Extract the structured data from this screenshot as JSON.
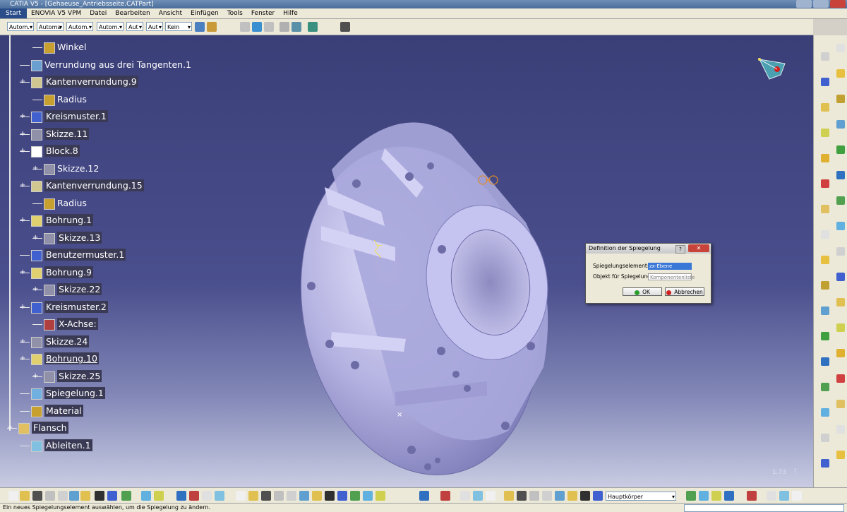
{
  "window": {
    "title": "CATIA V5 - [Gehaeuse_Antriebsseite.CATPart]"
  },
  "menu": {
    "start": "Start",
    "items": [
      "ENOVIA V5 VPM",
      "Datei",
      "Bearbeiten",
      "Ansicht",
      "Einfügen",
      "Tools",
      "Fenster",
      "Hilfe"
    ]
  },
  "toolbar": {
    "combos": [
      "Autom.",
      "Automa",
      "Autom.",
      "Autom.",
      "Aut",
      "Aut",
      "Kein"
    ]
  },
  "tree": {
    "items": [
      {
        "label": "Winkel",
        "icon": "parameter-icon"
      },
      {
        "label": "Verrundung aus drei Tangenten.1",
        "icon": "fillet-icon"
      },
      {
        "label": "Kantenverrundung.9",
        "icon": "edge-fillet-icon"
      },
      {
        "label": "Radius",
        "icon": "parameter-icon"
      },
      {
        "label": "Kreismuster.1",
        "icon": "circular-pattern-icon"
      },
      {
        "label": "Skizze.11",
        "icon": "sketch-icon"
      },
      {
        "label": "Block.8",
        "icon": "pad-icon"
      },
      {
        "label": "Skizze.12",
        "icon": "sketch-icon"
      },
      {
        "label": "Kantenverrundung.15",
        "icon": "edge-fillet-icon"
      },
      {
        "label": "Radius",
        "icon": "parameter-icon"
      },
      {
        "label": "Bohrung.1",
        "icon": "hole-icon"
      },
      {
        "label": "Skizze.13",
        "icon": "sketch-icon"
      },
      {
        "label": "Benutzermuster.1",
        "icon": "user-pattern-icon"
      },
      {
        "label": "Bohrung.9",
        "icon": "hole-icon"
      },
      {
        "label": "Skizze.22",
        "icon": "sketch-icon"
      },
      {
        "label": "Kreismuster.2",
        "icon": "circular-pattern-icon"
      },
      {
        "label": "X-Achse:",
        "icon": "axis-icon"
      },
      {
        "label": "Skizze.24",
        "icon": "sketch-icon"
      },
      {
        "label": "Bohrung.10",
        "icon": "hole-icon"
      },
      {
        "label": "Skizze.25",
        "icon": "sketch-icon"
      },
      {
        "label": "Spiegelung.1",
        "icon": "mirror-icon"
      },
      {
        "label": "Material",
        "icon": "material-icon"
      },
      {
        "label": "Flansch",
        "icon": "body-icon"
      },
      {
        "label": "Ableiten.1",
        "icon": "derive-icon"
      }
    ]
  },
  "dialog": {
    "title": "Definition der Spiegelung",
    "help": "?",
    "close": "✕",
    "mirror_element_label": "Spiegelungselement:",
    "mirror_element_value": "zx-Ebene",
    "object_label": "Objekt für Spiegelung:",
    "object_value": "Komponentenliste",
    "ok": "OK",
    "cancel": "Abbrechen"
  },
  "viewport": {
    "scale": "1.73"
  },
  "bottom": {
    "body_select": "Hauptkörper"
  },
  "status": {
    "text": "Ein neues Spiegelungselement auswählen, um die Spiegelung zu ändern."
  },
  "colors": {
    "background_top": "#3b3f78",
    "background_bottom": "#c9cce2",
    "part": "#b9b8e6",
    "dialog_ok": "#2a9d2a",
    "dialog_cancel": "#d02020"
  }
}
